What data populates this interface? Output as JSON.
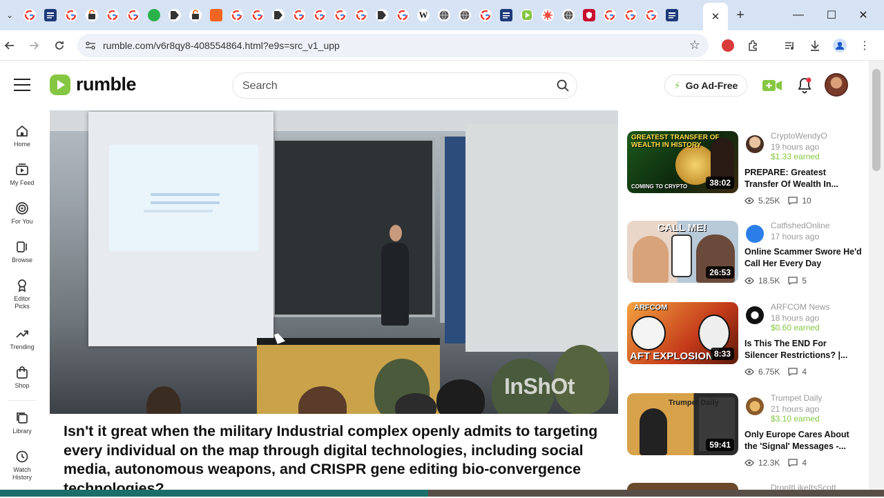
{
  "browser": {
    "url": "rumble.com/v6r8qy8-408554864.html?e9s=src_v1_upp",
    "tab_icons": [
      "google-icon",
      "news-icon",
      "google-icon",
      "extension-icon",
      "google-icon",
      "google-icon",
      "green-dot-icon",
      "video-icon",
      "extension-icon",
      "orange-icon",
      "google-icon",
      "google-icon",
      "video-icon",
      "google-icon",
      "google-icon",
      "google-icon",
      "google-icon",
      "video-icon",
      "google-icon",
      "wikipedia-icon",
      "globe-icon",
      "globe-icon",
      "google-icon",
      "news-icon",
      "rumble-icon",
      "virus-icon",
      "globe-icon",
      "shield-icon",
      "google-icon",
      "google-icon",
      "google-icon",
      "news-icon"
    ],
    "tab_wikipedia_glyph": "W",
    "close_tab_glyph": "✕",
    "new_tab_glyph": "+",
    "window_controls": {
      "minimize": "—",
      "maximize": "☐",
      "close": "✕"
    }
  },
  "header": {
    "logo_text": "rumble",
    "search_placeholder": "Search",
    "go_ad_free_label": "Go Ad-Free",
    "colors": {
      "brand": "#85c742"
    }
  },
  "sidebar": {
    "items": [
      {
        "label": "Home",
        "icon": "home-icon"
      },
      {
        "label": "My Feed",
        "icon": "feed-icon"
      },
      {
        "label": "For You",
        "icon": "target-icon"
      },
      {
        "label": "Browse",
        "icon": "browse-icon"
      },
      {
        "label": "Editor Picks",
        "icon": "award-icon"
      },
      {
        "label": "Trending",
        "icon": "trending-icon"
      },
      {
        "label": "Shop",
        "icon": "shop-icon"
      },
      {
        "label": "Library",
        "icon": "library-icon"
      },
      {
        "label": "Watch History",
        "icon": "history-icon"
      }
    ]
  },
  "video": {
    "watermark": "InShOt",
    "title": "Isn't it great when the military Industrial complex openly admits to targeting every individual on the map through digital technologies, including social media, autonomous weapons, and CRISPR gene editing bio-convergence technologies?"
  },
  "recommended": [
    {
      "channel": "CryptoWendyO",
      "ago": "19 hours ago",
      "earned": "$1.33 earned",
      "title": "PREPARE: Greatest Transfer Of Wealth In...",
      "views": "5.25K",
      "comments": "10",
      "duration": "38:02",
      "thumb_text": "Greatest Transfer of Wealth in History",
      "thumb_sub": "Coming to Crypto"
    },
    {
      "channel": "CatfishedOnline",
      "ago": "17 hours ago",
      "earned": "",
      "title": "Online Scammer Swore He'd Call Her Every Day",
      "views": "18.5K",
      "comments": "5",
      "duration": "26:53",
      "thumb_text": "CALL ME!",
      "thumb_sub": ""
    },
    {
      "channel": "ARFCOM News",
      "ago": "18 hours ago",
      "earned": "$0.60 earned",
      "title": "Is This The END For Silencer Restrictions? |...",
      "views": "6.75K",
      "comments": "4",
      "duration": "8:33",
      "thumb_text": "ARFCOM",
      "thumb_sub": "AFT EXPLOSION"
    },
    {
      "channel": "Trumpet Daily",
      "ago": "21 hours ago",
      "earned": "$3.10 earned",
      "title": "Only Europe Cares About the 'Signal' Messages -...",
      "views": "12.3K",
      "comments": "4",
      "duration": "59:41",
      "thumb_text": "Trumpet Daily",
      "thumb_sub": ""
    },
    {
      "channel": "DropItLikeItsScott",
      "ago": "",
      "earned": "",
      "title": "",
      "views": "",
      "comments": "",
      "duration": "",
      "thumb_text": "",
      "thumb_sub": ""
    }
  ]
}
